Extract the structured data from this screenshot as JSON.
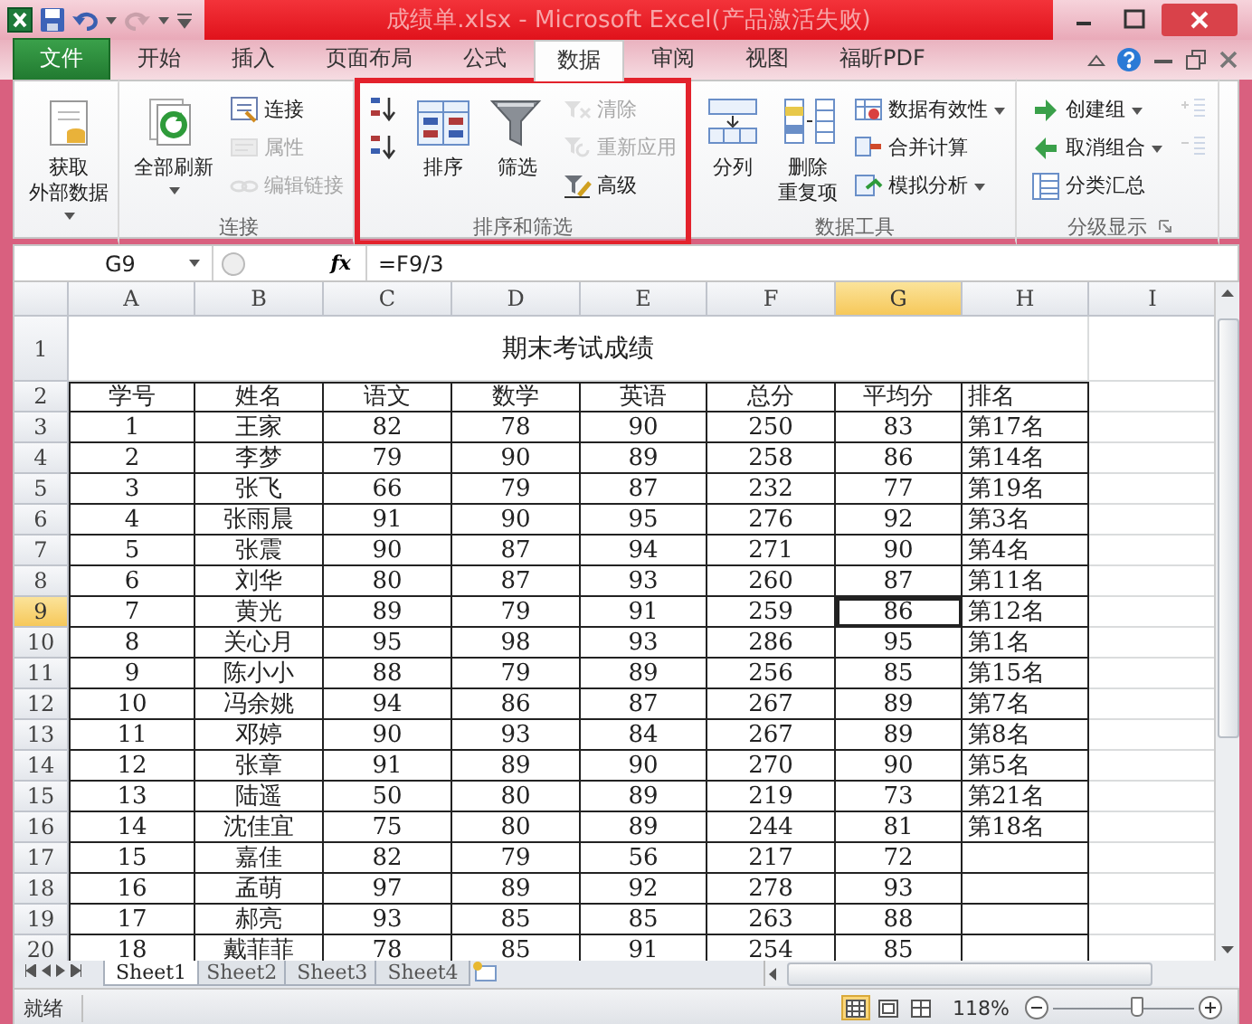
{
  "title_bar": {
    "title": "成绩单.xlsx - Microsoft Excel(产品激活失败)"
  },
  "ribbon_tabs": [
    {
      "label": "文件",
      "kind": "file",
      "selected": false
    },
    {
      "label": "开始",
      "kind": "tab",
      "selected": false
    },
    {
      "label": "插入",
      "kind": "tab",
      "selected": false
    },
    {
      "label": "页面布局",
      "kind": "tab",
      "selected": false
    },
    {
      "label": "公式",
      "kind": "tab",
      "selected": false
    },
    {
      "label": "数据",
      "kind": "tab",
      "selected": true
    },
    {
      "label": "审阅",
      "kind": "tab",
      "selected": false
    },
    {
      "label": "视图",
      "kind": "tab",
      "selected": false
    },
    {
      "label": "福昕PDF",
      "kind": "tab",
      "selected": false
    }
  ],
  "ribbon_groups": [
    {
      "highlighted": false,
      "buttons": [
        {
          "kind": "large",
          "label_lines": [
            "获取",
            "外部数据"
          ],
          "dropdown": true,
          "disabled": false
        }
      ]
    },
    {
      "label": "连接",
      "highlighted": false,
      "buttons": [
        {
          "kind": "large",
          "label": "全部刷新",
          "dropdown": true,
          "disabled": false
        },
        {
          "kind": "small",
          "label": "连接",
          "disabled": false
        },
        {
          "kind": "small",
          "label": "属性",
          "disabled": true
        },
        {
          "kind": "small",
          "label": "编辑链接",
          "disabled": true
        }
      ]
    },
    {
      "label": "排序和筛选",
      "highlighted": true,
      "buttons": [
        {
          "kind": "small",
          "disabled": false
        },
        {
          "kind": "small",
          "disabled": false
        },
        {
          "kind": "large",
          "label": "排序",
          "disabled": false
        },
        {
          "kind": "large",
          "label": "筛选",
          "disabled": false
        },
        {
          "kind": "small",
          "label": "清除",
          "disabled": true
        },
        {
          "kind": "small",
          "label": "重新应用",
          "disabled": true
        },
        {
          "kind": "small",
          "label": "高级",
          "disabled": false
        }
      ]
    },
    {
      "label": "数据工具",
      "highlighted": false,
      "buttons": [
        {
          "kind": "large",
          "label": "分列",
          "disabled": false
        },
        {
          "kind": "large",
          "label_lines": [
            "删除",
            "重复项"
          ],
          "disabled": false
        },
        {
          "kind": "small",
          "label": "数据有效性",
          "dropdown": true,
          "disabled": false
        },
        {
          "kind": "small",
          "label": "合并计算",
          "disabled": false
        },
        {
          "kind": "small",
          "label": "模拟分析",
          "dropdown": true,
          "disabled": false
        }
      ]
    },
    {
      "label": "分级显示",
      "highlighted": false,
      "launcher": true,
      "buttons": [
        {
          "kind": "small",
          "label": "创建组",
          "dropdown": true,
          "disabled": false
        },
        {
          "kind": "small",
          "label": "取消组合",
          "dropdown": true,
          "disabled": false
        },
        {
          "kind": "small",
          "label": "分类汇总",
          "disabled": false
        },
        {
          "kind": "small",
          "disabled": true
        },
        {
          "kind": "small",
          "disabled": true
        }
      ]
    }
  ],
  "formula_bar": {
    "name_box": "G9",
    "function_label": "fx",
    "formula": "=F9/3"
  },
  "sheet": {
    "columns": [
      {
        "label": "A",
        "selected": false
      },
      {
        "label": "B",
        "selected": false
      },
      {
        "label": "C",
        "selected": false
      },
      {
        "label": "D",
        "selected": false
      },
      {
        "label": "E",
        "selected": false
      },
      {
        "label": "F",
        "selected": false
      },
      {
        "label": "G",
        "selected": true
      },
      {
        "label": "H",
        "selected": false
      },
      {
        "label": "I",
        "selected": false
      }
    ],
    "rows": [
      {
        "number": "1",
        "kind": "title",
        "selected": false,
        "cells": [
          "",
          "",
          "",
          "期末考试成绩"
        ]
      },
      {
        "number": "2",
        "kind": "header",
        "selected": false,
        "cells": [
          "学号",
          "姓名",
          "语文",
          "数学",
          "英语",
          "总分",
          "平均分",
          "排名"
        ]
      },
      {
        "number": "3",
        "kind": "data",
        "selected": false,
        "cells": [
          "1",
          "王家",
          "82",
          "78",
          "90",
          "250",
          "83",
          "第17名"
        ]
      },
      {
        "number": "4",
        "kind": "data",
        "selected": false,
        "cells": [
          "2",
          "李梦",
          "79",
          "90",
          "89",
          "258",
          "86",
          "第14名"
        ]
      },
      {
        "number": "5",
        "kind": "data",
        "selected": false,
        "cells": [
          "3",
          "张飞",
          "66",
          "79",
          "87",
          "232",
          "77",
          "第19名"
        ]
      },
      {
        "number": "6",
        "kind": "data",
        "selected": false,
        "cells": [
          "4",
          "张雨晨",
          "91",
          "90",
          "95",
          "276",
          "92",
          "第3名"
        ]
      },
      {
        "number": "7",
        "kind": "data",
        "selected": false,
        "cells": [
          "5",
          "张震",
          "90",
          "87",
          "94",
          "271",
          "90",
          "第4名"
        ]
      },
      {
        "number": "8",
        "kind": "data",
        "selected": false,
        "cells": [
          "6",
          "刘华",
          "80",
          "87",
          "93",
          "260",
          "87",
          "第11名"
        ]
      },
      {
        "number": "9",
        "kind": "data",
        "selected": true,
        "cells": [
          "7",
          "黄光",
          "89",
          "79",
          "91",
          "259",
          "86",
          "第12名"
        ]
      },
      {
        "number": "10",
        "kind": "data",
        "selected": false,
        "cells": [
          "8",
          "关心月",
          "95",
          "98",
          "93",
          "286",
          "95",
          "第1名"
        ]
      },
      {
        "number": "11",
        "kind": "data",
        "selected": false,
        "cells": [
          "9",
          "陈小小",
          "88",
          "79",
          "89",
          "256",
          "85",
          "第15名"
        ]
      },
      {
        "number": "12",
        "kind": "data",
        "selected": false,
        "cells": [
          "10",
          "冯余姚",
          "94",
          "86",
          "87",
          "267",
          "89",
          "第7名"
        ]
      },
      {
        "number": "13",
        "kind": "data",
        "selected": false,
        "cells": [
          "11",
          "邓婷",
          "90",
          "93",
          "84",
          "267",
          "89",
          "第8名"
        ]
      },
      {
        "number": "14",
        "kind": "data",
        "selected": false,
        "cells": [
          "12",
          "张章",
          "91",
          "89",
          "90",
          "270",
          "90",
          "第5名"
        ]
      },
      {
        "number": "15",
        "kind": "data",
        "selected": false,
        "cells": [
          "13",
          "陆遥",
          "50",
          "80",
          "89",
          "219",
          "73",
          "第21名"
        ]
      },
      {
        "number": "16",
        "kind": "data",
        "selected": false,
        "cells": [
          "14",
          "沈佳宜",
          "75",
          "80",
          "89",
          "244",
          "81",
          "第18名"
        ]
      },
      {
        "number": "17",
        "kind": "data",
        "selected": false,
        "cells": [
          "15",
          "嘉佳",
          "82",
          "79",
          "56",
          "217",
          "72"
        ]
      },
      {
        "number": "18",
        "kind": "data",
        "selected": false,
        "cells": [
          "16",
          "孟萌",
          "97",
          "89",
          "92",
          "278",
          "93"
        ]
      },
      {
        "number": "19",
        "kind": "data",
        "selected": false,
        "cells": [
          "17",
          "郝亮",
          "93",
          "85",
          "85",
          "263",
          "88"
        ]
      },
      {
        "number": "20",
        "kind": "data",
        "selected": false,
        "cells": [
          "18",
          "戴菲菲",
          "78",
          "85",
          "91",
          "254",
          "85"
        ]
      }
    ]
  },
  "sheet_tabs": [
    {
      "label": "Sheet1",
      "selected": true
    },
    {
      "label": "Sheet2",
      "selected": false
    },
    {
      "label": "Sheet3",
      "selected": false
    },
    {
      "label": "Sheet4",
      "selected": false
    }
  ],
  "status_bar": {
    "status": "就绪",
    "views": [
      {
        "kind": "normal",
        "selected": true
      },
      {
        "kind": "layout",
        "selected": false
      },
      {
        "kind": "break",
        "selected": false
      }
    ],
    "zoom": "118%",
    "zoom_slider": {
      "level": 0.6
    }
  }
}
